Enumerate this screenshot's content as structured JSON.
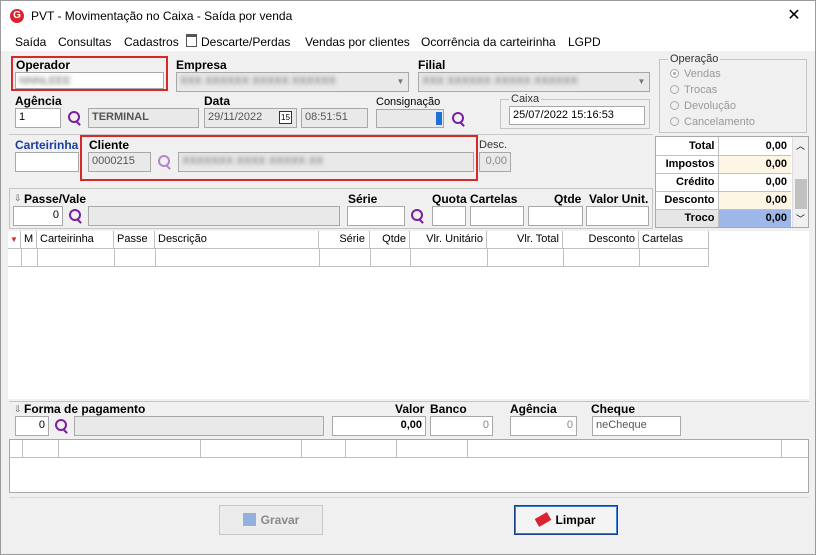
{
  "window": {
    "title": "PVT - Movimentação no Caixa - Saída por venda",
    "logo": "G",
    "close": "✕"
  },
  "menu": [
    "Saída",
    "Consultas",
    "Cadastros",
    "Descarte/Perdas",
    "Vendas por clientes",
    "Ocorrência da carteirinha",
    "LGPD"
  ],
  "operador": {
    "label": "Operador",
    "value": "NNNLEEE"
  },
  "empresa": {
    "label": "Empresa",
    "value": "XXX XXXXXX XXXXX XXXXXX"
  },
  "filial": {
    "label": "Filial",
    "value": "XXX XXXXXX XXXXX XXXXXX"
  },
  "agencia": {
    "label": "Agência",
    "value": "1",
    "name": "TERMINAL"
  },
  "data": {
    "label": "Data",
    "date": "29/11/2022",
    "date_btn": "15",
    "time": "08:51:51"
  },
  "consignacao": {
    "label": "Consignação"
  },
  "caixa": {
    "label": "Caixa",
    "value": "25/07/2022 15:16:53"
  },
  "operacao": {
    "label": "Operação",
    "options": [
      "Vendas",
      "Trocas",
      "Devolução",
      "Cancelamento"
    ]
  },
  "carteirinha": {
    "label": "Carteirinha"
  },
  "cliente": {
    "label": "Cliente",
    "code": "0000215",
    "name": "XXXXXXX XXXX XXXXX XX"
  },
  "desc": {
    "label": "Desc.",
    "value": "0,00"
  },
  "totals": [
    {
      "label": "Total",
      "value": "0,00"
    },
    {
      "label": "Impostos",
      "value": "0,00"
    },
    {
      "label": "Crédito",
      "value": "0,00"
    },
    {
      "label": "Desconto",
      "value": "0,00"
    },
    {
      "label": "Troco",
      "value": "0,00"
    }
  ],
  "passe": {
    "label": "Passe/Vale",
    "value": "0",
    "serie_label": "Série",
    "quota_label": "Quota",
    "cartelas_label": "Cartelas",
    "qtde_label": "Qtde",
    "valor_label": "Valor Unit."
  },
  "items_grid": {
    "headers": [
      "M",
      "Carteirinha",
      "Passe",
      "Descrição",
      "Série",
      "Qtde",
      "Vlr. Unitário",
      "Vlr. Total",
      "Desconto",
      "Cartelas"
    ]
  },
  "pagamento": {
    "label": "Forma de pagamento",
    "value": "0",
    "valor_label": "Valor",
    "valor": "0,00",
    "banco_label": "Banco",
    "banco": "0",
    "agencia_label": "Agência",
    "agencia": "0",
    "cheque_label": "Cheque",
    "cheque": "neCheque"
  },
  "buttons": {
    "gravar": "Gravar",
    "limpar": "Limpar"
  },
  "colors": {
    "red_highlight": "#d42a2a",
    "search_icon": "#7a1fa2",
    "troco_bg": "#9db7e8"
  }
}
